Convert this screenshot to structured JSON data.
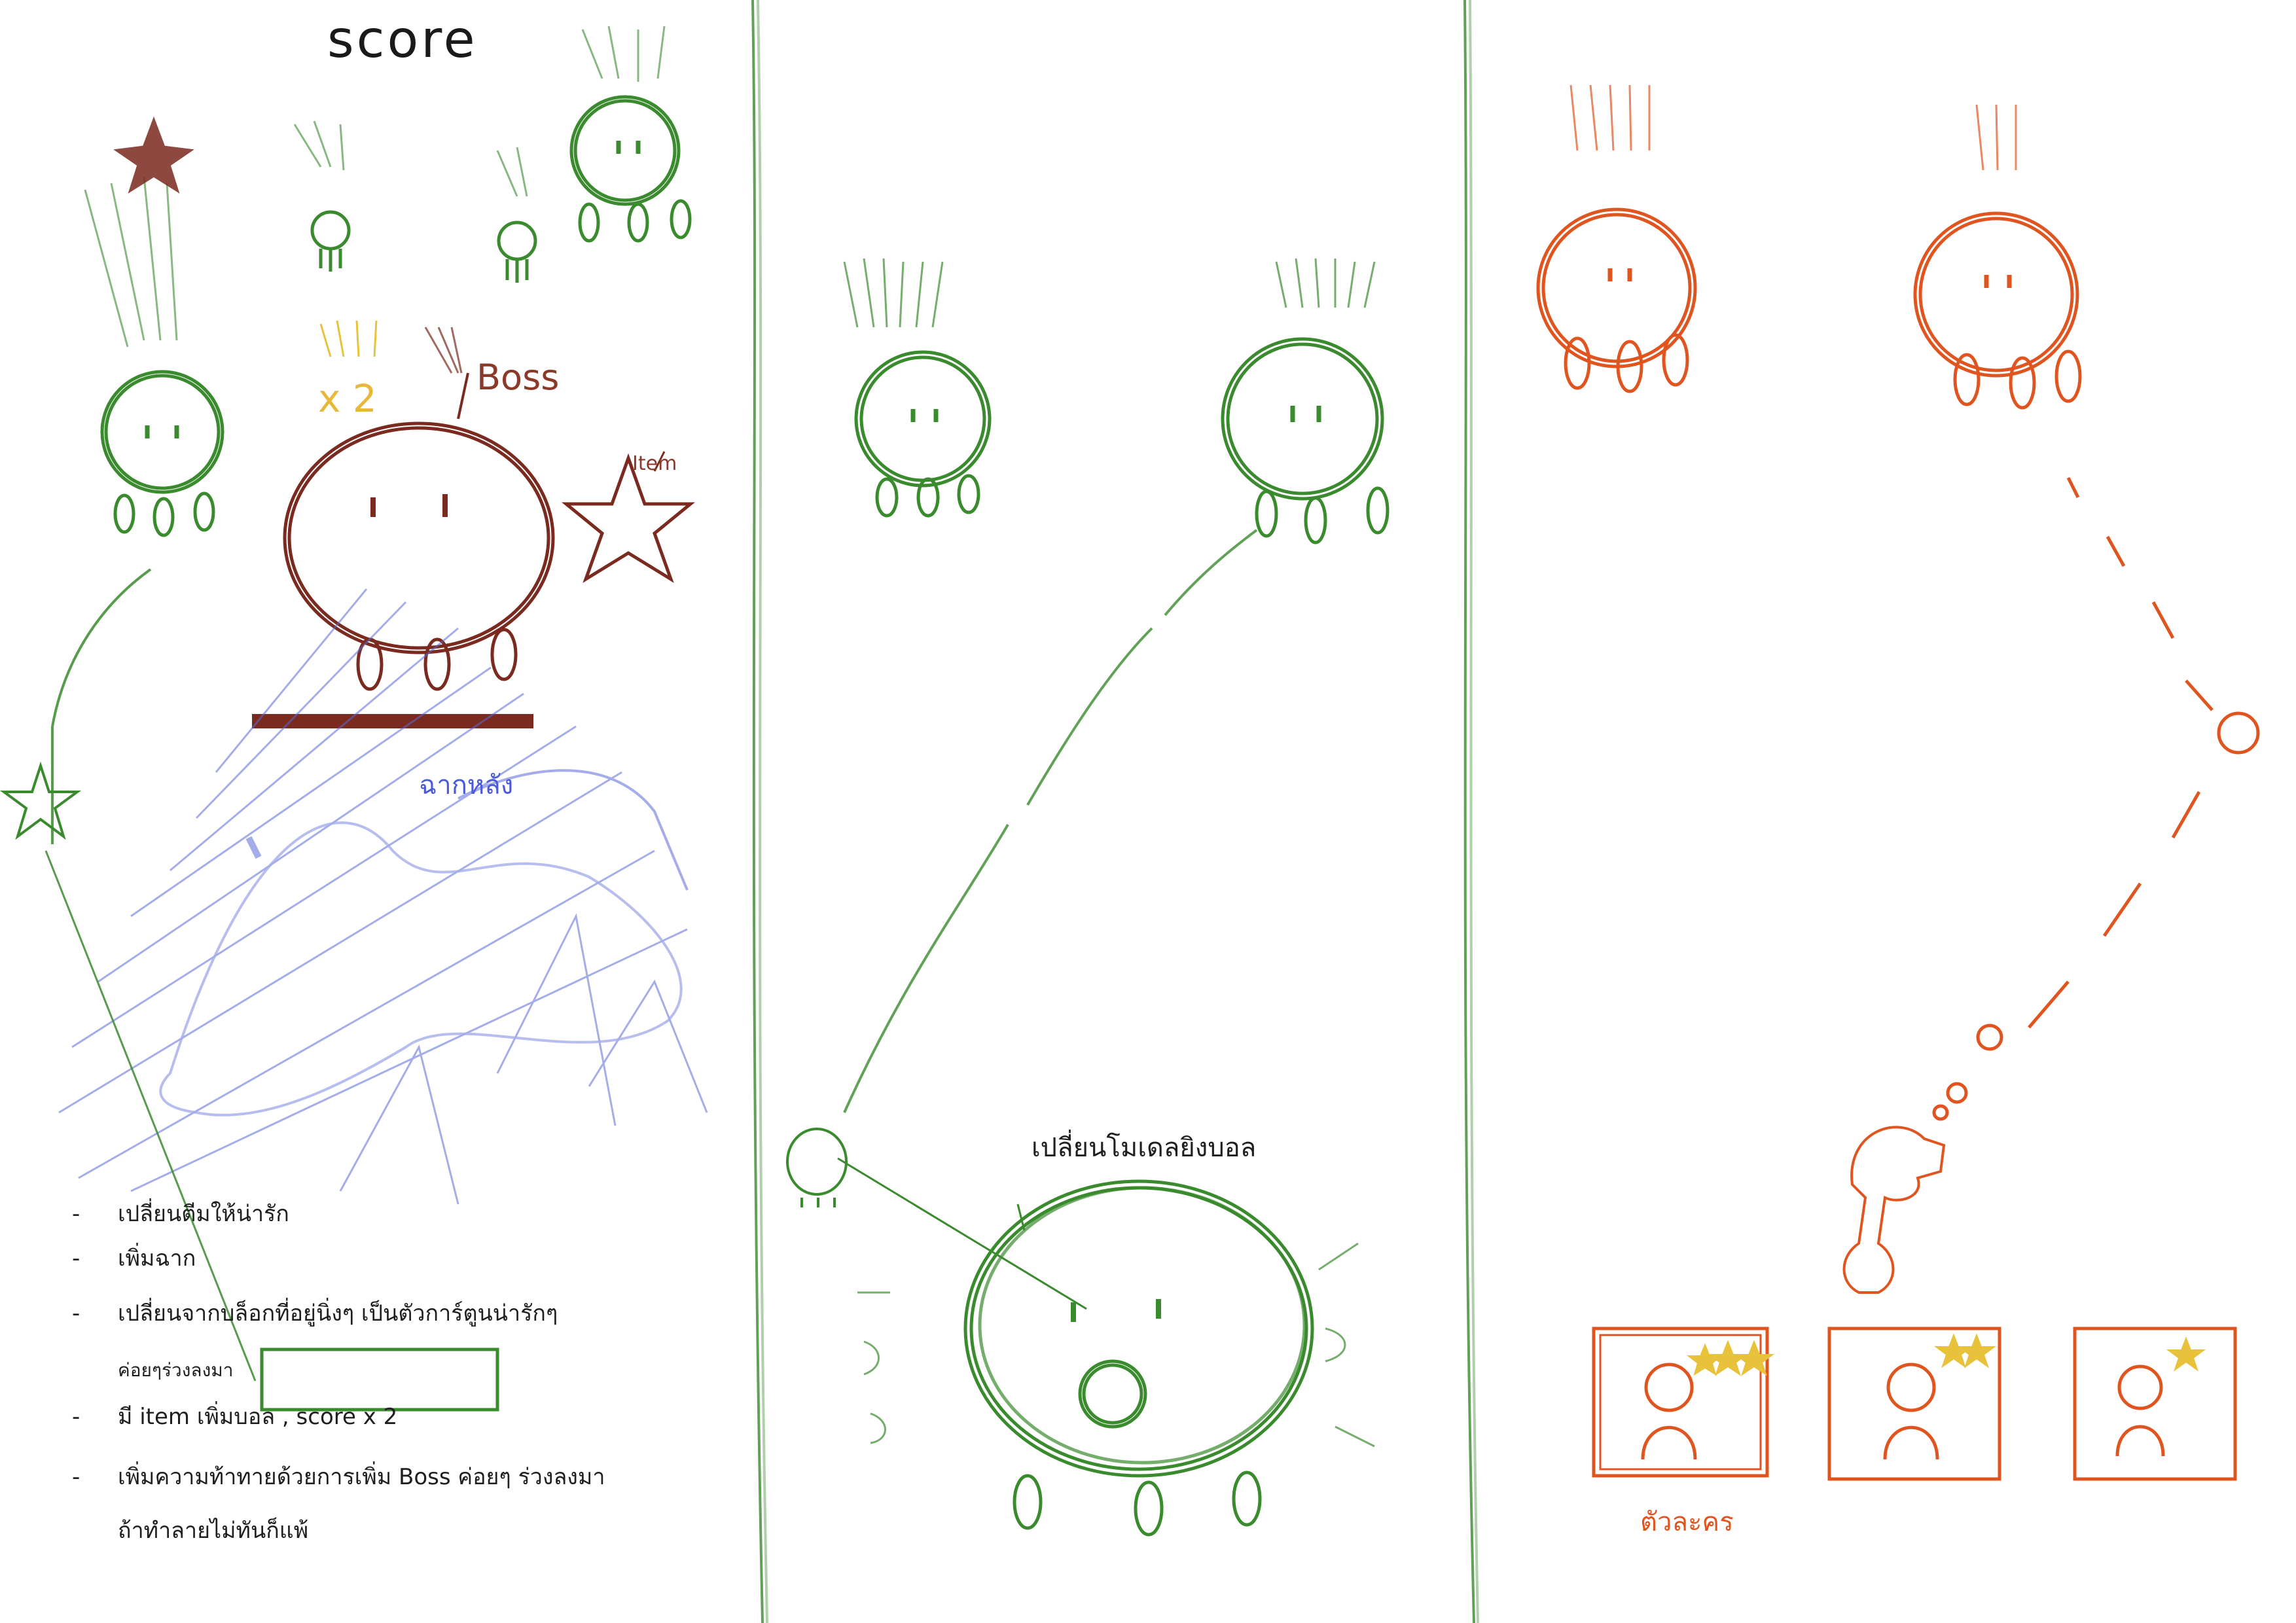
{
  "panel_left": {
    "score_title": "score",
    "multiplier_label": "x 2",
    "boss_label": "Boss",
    "item_label": "Item",
    "background_label": "ฉากหลัง",
    "notes": [
      "เปลี่ยนตีมให้น่ารัก",
      "เพิ่มฉาก",
      "เปลี่ยนจากบล็อกที่อยู่นิ่งๆ เป็นตัวการ์ตูนน่ารักๆ",
      "ค่อยๆร่วงลงมา",
      "มี item เพิ่มบอล , score x 2",
      "เพิ่มความท้าทายด้วยการเพิ่ม Boss ค่อยๆ ร่วงลงมา",
      "ถ้าทำลายไม่ทันก็แพ้"
    ]
  },
  "panel_middle": {
    "model_label": "เปลี่ยนโมเดลยิงบอล"
  },
  "panel_right": {
    "characters_label": "ตัวละคร",
    "character_cards": [
      {
        "stars": 3
      },
      {
        "stars": 2
      },
      {
        "stars": 1
      }
    ]
  },
  "colors": {
    "green": "#3a8a2e",
    "brown": "#7a2a1e",
    "blue": "#5a6ad8",
    "orange": "#e0551f",
    "yellow": "#e8c23a",
    "ink": "#1f1f1f"
  }
}
